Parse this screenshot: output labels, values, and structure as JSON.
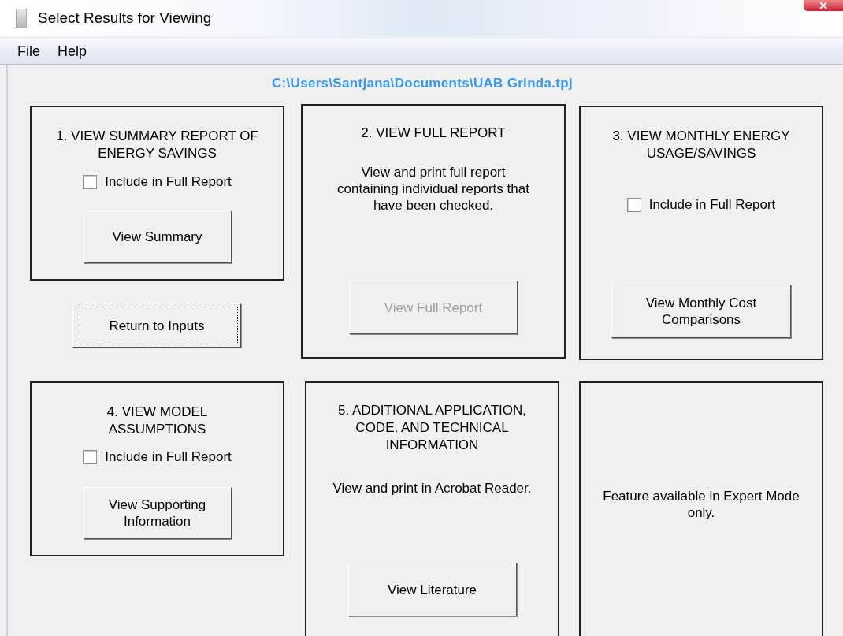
{
  "window": {
    "title": "Select Results for Viewing"
  },
  "menu": [
    "File",
    "Help"
  ],
  "path": "C:\\Users\\Santjana\\Documents\\UAB Grinda.tpj",
  "panels": [
    {
      "heading": "1. VIEW SUMMARY REPORT OF ENERGY SAVINGS",
      "checkbox": {
        "label": "Include in Full Report",
        "checked": false
      },
      "button": {
        "label": "View Summary",
        "disabled": false
      }
    },
    {
      "heading": "2. VIEW FULL REPORT",
      "description": "View and print full report containing individual reports that have been checked.",
      "button": {
        "label": "View Full Report",
        "disabled": true
      }
    },
    {
      "heading": "3. VIEW MONTHLY ENERGY USAGE/SAVINGS",
      "checkbox": {
        "label": "Include in Full Report",
        "checked": false
      },
      "button": {
        "label": "View Monthly Cost Comparisons",
        "disabled": false
      }
    },
    {
      "heading": "4. VIEW MODEL ASSUMPTIONS",
      "checkbox": {
        "label": "Include in Full Report",
        "checked": false
      },
      "button": {
        "label": "View Supporting Information",
        "disabled": false
      }
    },
    {
      "heading": "5. ADDITIONAL APPLICATION, CODE, AND TECHNICAL INFORMATION",
      "description": "View and print in Acrobat Reader.",
      "button": {
        "label": "View Literature",
        "disabled": false
      }
    },
    {
      "description": "Feature available in Expert Mode only."
    }
  ],
  "return_button": {
    "label": "Return to Inputs",
    "focused": true
  }
}
